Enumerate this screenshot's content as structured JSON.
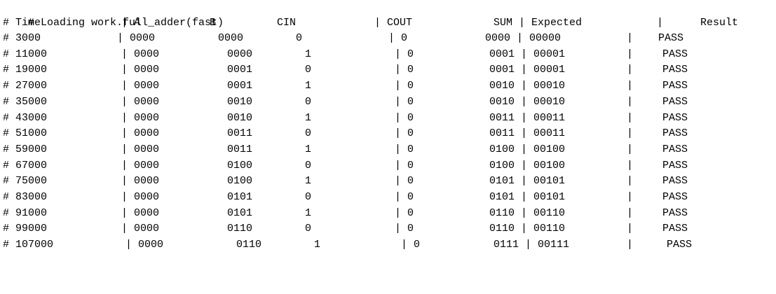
{
  "console": {
    "loading_line": "# Loading work.full_adder(fast)",
    "header": {
      "time": "# Time",
      "a": "| A",
      "b": "B",
      "cin": "CIN",
      "cout": "| COUT",
      "sum": "SUM | Expected",
      "bar": "|",
      "result": "Result"
    },
    "rows": [
      {
        "time": "# 3000",
        "a": "| 0000",
        "b": "0000",
        "cin": "0",
        "cout": "| 0",
        "sum": "0000 | 00000",
        "bar": "|",
        "result": "PASS"
      },
      {
        "time": "# 11000",
        "a": "| 0000",
        "b": "0000",
        "cin": "1",
        "cout": "| 0",
        "sum": "0001 | 00001",
        "bar": "|",
        "result": "PASS"
      },
      {
        "time": "# 19000",
        "a": "| 0000",
        "b": "0001",
        "cin": "0",
        "cout": "| 0",
        "sum": "0001 | 00001",
        "bar": "|",
        "result": "PASS"
      },
      {
        "time": "# 27000",
        "a": "| 0000",
        "b": "0001",
        "cin": "1",
        "cout": "| 0",
        "sum": "0010 | 00010",
        "bar": "|",
        "result": "PASS"
      },
      {
        "time": "# 35000",
        "a": "| 0000",
        "b": "0010",
        "cin": "0",
        "cout": "| 0",
        "sum": "0010 | 00010",
        "bar": "|",
        "result": "PASS"
      },
      {
        "time": "# 43000",
        "a": "| 0000",
        "b": "0010",
        "cin": "1",
        "cout": "| 0",
        "sum": "0011 | 00011",
        "bar": "|",
        "result": "PASS"
      },
      {
        "time": "# 51000",
        "a": "| 0000",
        "b": "0011",
        "cin": "0",
        "cout": "| 0",
        "sum": "0011 | 00011",
        "bar": "|",
        "result": "PASS"
      },
      {
        "time": "# 59000",
        "a": "| 0000",
        "b": "0011",
        "cin": "1",
        "cout": "| 0",
        "sum": "0100 | 00100",
        "bar": "|",
        "result": "PASS"
      },
      {
        "time": "# 67000",
        "a": "| 0000",
        "b": "0100",
        "cin": "0",
        "cout": "| 0",
        "sum": "0100 | 00100",
        "bar": "|",
        "result": "PASS"
      },
      {
        "time": "# 75000",
        "a": "| 0000",
        "b": "0100",
        "cin": "1",
        "cout": "| 0",
        "sum": "0101 | 00101",
        "bar": "|",
        "result": "PASS"
      },
      {
        "time": "# 83000",
        "a": "| 0000",
        "b": "0101",
        "cin": "0",
        "cout": "| 0",
        "sum": "0101 | 00101",
        "bar": "|",
        "result": "PASS"
      },
      {
        "time": "# 91000",
        "a": "| 0000",
        "b": "0101",
        "cin": "1",
        "cout": "| 0",
        "sum": "0110 | 00110",
        "bar": "|",
        "result": "PASS"
      },
      {
        "time": "# 99000",
        "a": "| 0000",
        "b": "0110",
        "cin": "0",
        "cout": "| 0",
        "sum": "0110 | 00110",
        "bar": "|",
        "result": "PASS"
      },
      {
        "time": "# 107000",
        "a": "| 0000",
        "b": "0110",
        "cin": "1",
        "cout": "| 0",
        "sum": "0111 | 00111",
        "bar": "|",
        "result": "PASS"
      }
    ]
  }
}
